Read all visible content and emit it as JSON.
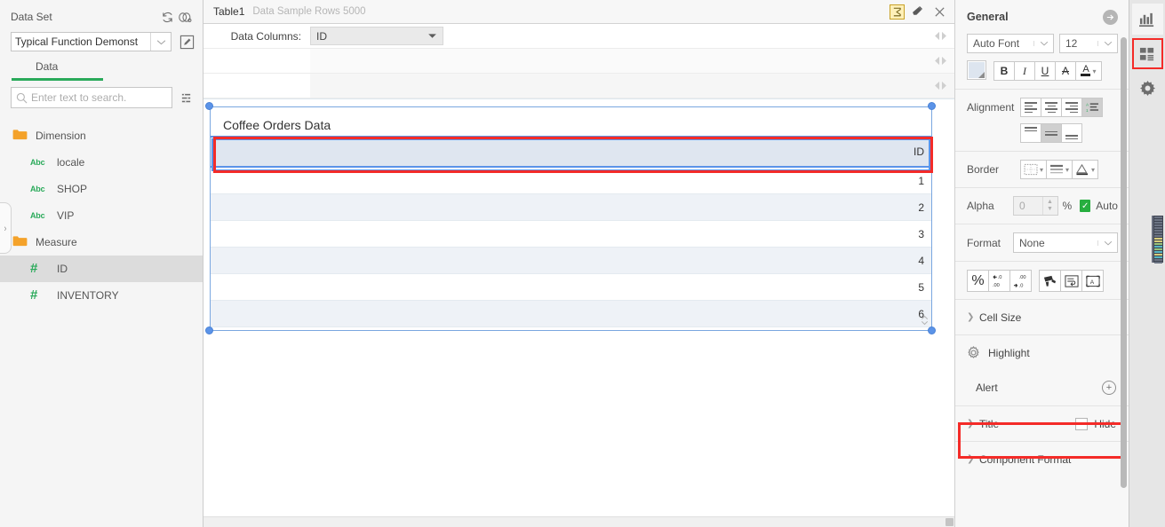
{
  "sidebar": {
    "dataset_label": "Data Set",
    "dataset_value": "Typical Function Demonst",
    "refresh_icon": "refresh-icon",
    "link_icon": "linked-data-icon",
    "edit_icon": "edit-dataset-icon",
    "tab_label": "Data",
    "search_placeholder": "Enter text to search.",
    "search_value": "",
    "menu_icon": "list-options-icon",
    "tree": [
      {
        "label": "Dimension",
        "type": "folder",
        "indent": 0,
        "selected": false
      },
      {
        "label": "locale",
        "type": "abc",
        "indent": 1,
        "selected": false
      },
      {
        "label": "SHOP",
        "type": "abc",
        "indent": 1,
        "selected": false
      },
      {
        "label": "VIP",
        "type": "abc",
        "indent": 1,
        "selected": false
      },
      {
        "label": "Measure",
        "type": "folder",
        "indent": 0,
        "selected": false
      },
      {
        "label": "ID",
        "type": "num",
        "indent": 1,
        "selected": true
      },
      {
        "label": "INVENTORY",
        "type": "num",
        "indent": 1,
        "selected": false
      }
    ],
    "collapse_glyph": "›"
  },
  "center": {
    "table_name": "Table1",
    "table_subtitle": "Data Sample Rows 5000",
    "sigma_icon": "sum-sigma-icon",
    "eraser_icon": "eraser-icon",
    "close_icon": "close-icon",
    "data_columns_label": "Data Columns:",
    "data_columns_value": "ID",
    "rows_arrows_icon": "left-right-arrows-icon",
    "component": {
      "title": "Coffee Orders Data",
      "column_header": "ID",
      "rows": [
        "1",
        "2",
        "3",
        "4",
        "5",
        "6"
      ],
      "spinner_up": "▲",
      "spinner_down": "▼"
    }
  },
  "rpanel": {
    "title": "General",
    "forward_icon": "arrow-right-circle-icon",
    "font_family": "Auto Font",
    "font_size": "12",
    "font_buttons": [
      {
        "label": "B",
        "name": "bold-button"
      },
      {
        "label": "I",
        "name": "italic-button"
      },
      {
        "label": "U",
        "name": "underline-button"
      },
      {
        "label": "A",
        "name": "strikethrough-button"
      }
    ],
    "font_color_label": "A",
    "swatch_name": "fill-color-swatch",
    "alignment_label": "Alignment",
    "h_align": [
      {
        "name": "align-left-button",
        "on": false
      },
      {
        "name": "align-center-button",
        "on": false
      },
      {
        "name": "align-right-button",
        "on": false
      },
      {
        "name": "align-auto-button",
        "on": true
      }
    ],
    "v_align": [
      {
        "name": "align-top-button",
        "on": false
      },
      {
        "name": "align-middle-button",
        "on": true
      },
      {
        "name": "align-bottom-button",
        "on": false
      }
    ],
    "border_label": "Border",
    "border_buttons": [
      {
        "name": "border-style-button"
      },
      {
        "name": "border-weight-button"
      },
      {
        "name": "border-color-button"
      }
    ],
    "alpha_label": "Alpha",
    "alpha_value": "0",
    "alpha_unit": "%",
    "alpha_auto_label": "Auto",
    "alpha_auto_checked": true,
    "format_label": "Format",
    "format_value": "None",
    "format_tools": [
      {
        "name": "percent-format-button",
        "glyph": "%"
      },
      {
        "name": "decrease-decimal-button",
        "glyph": ".00"
      },
      {
        "name": "increase-decimal-button",
        "glyph": ".0"
      },
      {
        "name": "format-painter-button",
        "glyph": "brush"
      },
      {
        "name": "wrap-text-button",
        "glyph": "wrap"
      },
      {
        "name": "auto-fit-text-button",
        "glyph": "fit"
      }
    ],
    "sections": [
      {
        "label": "Cell Size",
        "name": "section-cell-size",
        "kind": "chevron"
      },
      {
        "label": "Highlight",
        "name": "section-highlight",
        "kind": "gear"
      },
      {
        "label": "Alert",
        "name": "section-alert",
        "kind": "plus",
        "highlighted": true
      },
      {
        "label": "Title",
        "name": "section-title",
        "kind": "chevron",
        "extra": "Hide"
      },
      {
        "label": "Component Format",
        "name": "section-component-format",
        "kind": "chevron"
      }
    ]
  },
  "strip": {
    "buttons": [
      {
        "name": "chart-panel-icon",
        "active": true,
        "boxed": false
      },
      {
        "name": "components-panel-icon",
        "active": false,
        "boxed": true
      },
      {
        "name": "settings-gear-icon",
        "active": false,
        "boxed": false
      }
    ]
  },
  "colors": {
    "accent_green": "#2aaa5a",
    "selection_blue": "#5b93e8",
    "highlight_red": "#f42b28",
    "check_green": "#27ae3f"
  }
}
